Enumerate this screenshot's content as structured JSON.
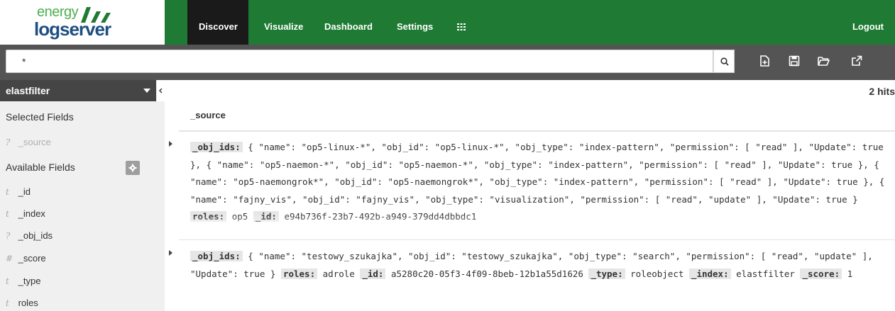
{
  "logo": {
    "line1": "energy",
    "line2": "logserver"
  },
  "nav": {
    "discover": "Discover",
    "visualize": "Visualize",
    "dashboard": "Dashboard",
    "settings": "Settings",
    "logout": "Logout"
  },
  "search": {
    "value": "*"
  },
  "sidebar": {
    "index": "elastfilter",
    "selected_heading": "Selected Fields",
    "selected_fields": [
      {
        "type": "?",
        "name": "_source"
      }
    ],
    "available_heading": "Available Fields",
    "available_fields": [
      {
        "type": "t",
        "name": "_id"
      },
      {
        "type": "t",
        "name": "_index"
      },
      {
        "type": "?",
        "name": "_obj_ids"
      },
      {
        "type": "#",
        "name": "_score"
      },
      {
        "type": "t",
        "name": "_type"
      },
      {
        "type": "t",
        "name": "roles"
      }
    ]
  },
  "results": {
    "hits": "2 hits",
    "column": "_source",
    "docs": [
      {
        "k_obj_ids": "_obj_ids:",
        "v_obj_ids": "{ \"name\": \"op5-linux-*\", \"obj_id\": \"op5-linux-*\", \"obj_type\": \"index-pattern\", \"permission\": [ \"read\" ], \"Update\": true }, { \"name\": \"op5-naemon-*\", \"obj_id\": \"op5-naemon-*\", \"obj_type\": \"index-pattern\", \"permission\": [ \"read\" ], \"Update\": true }, { \"name\": \"op5-naemongrok*\", \"obj_id\": \"op5-naemongrok*\", \"obj_type\": \"index-pattern\", \"permission\": [ \"read\" ], \"Update\": true }, { \"name\": \"fajny_vis\", \"obj_id\": \"fajny_vis\", \"obj_type\": \"visualization\", \"permission\": [ \"read\", \"update\" ], \"Update\": true }",
        "k_roles": "roles:",
        "v_roles": "op5",
        "k_id": "_id:",
        "v_id": "e94b736f-23b7-492b-a949-379dd4dbbdc1"
      },
      {
        "k_obj_ids": "_obj_ids:",
        "v_obj_ids": "{ \"name\": \"testowy_szukajka\", \"obj_id\": \"testowy_szukajka\", \"obj_type\": \"search\", \"permission\": [ \"read\", \"update\" ], \"Update\": true }",
        "k_roles": "roles:",
        "v_roles": "adrole",
        "k_id": "_id:",
        "v_id": "a5280c20-05f3-4f09-8beb-12b1a55d1626",
        "k_type": "_type:",
        "v_type": "roleobject",
        "k_index": "_index:",
        "v_index": "elastfilter",
        "k_score": "_score:",
        "v_score": "1"
      }
    ]
  },
  "colors": {
    "nav_green": "#1f7a34",
    "search_bar": "#545454",
    "sidebar_bg": "#f0f0f0"
  },
  "icons": [
    "search-icon",
    "new-search-icon",
    "save-icon",
    "open-icon",
    "share-icon",
    "apps-grid-icon",
    "gear-icon",
    "collapse-icon",
    "expand-row-icon"
  ]
}
